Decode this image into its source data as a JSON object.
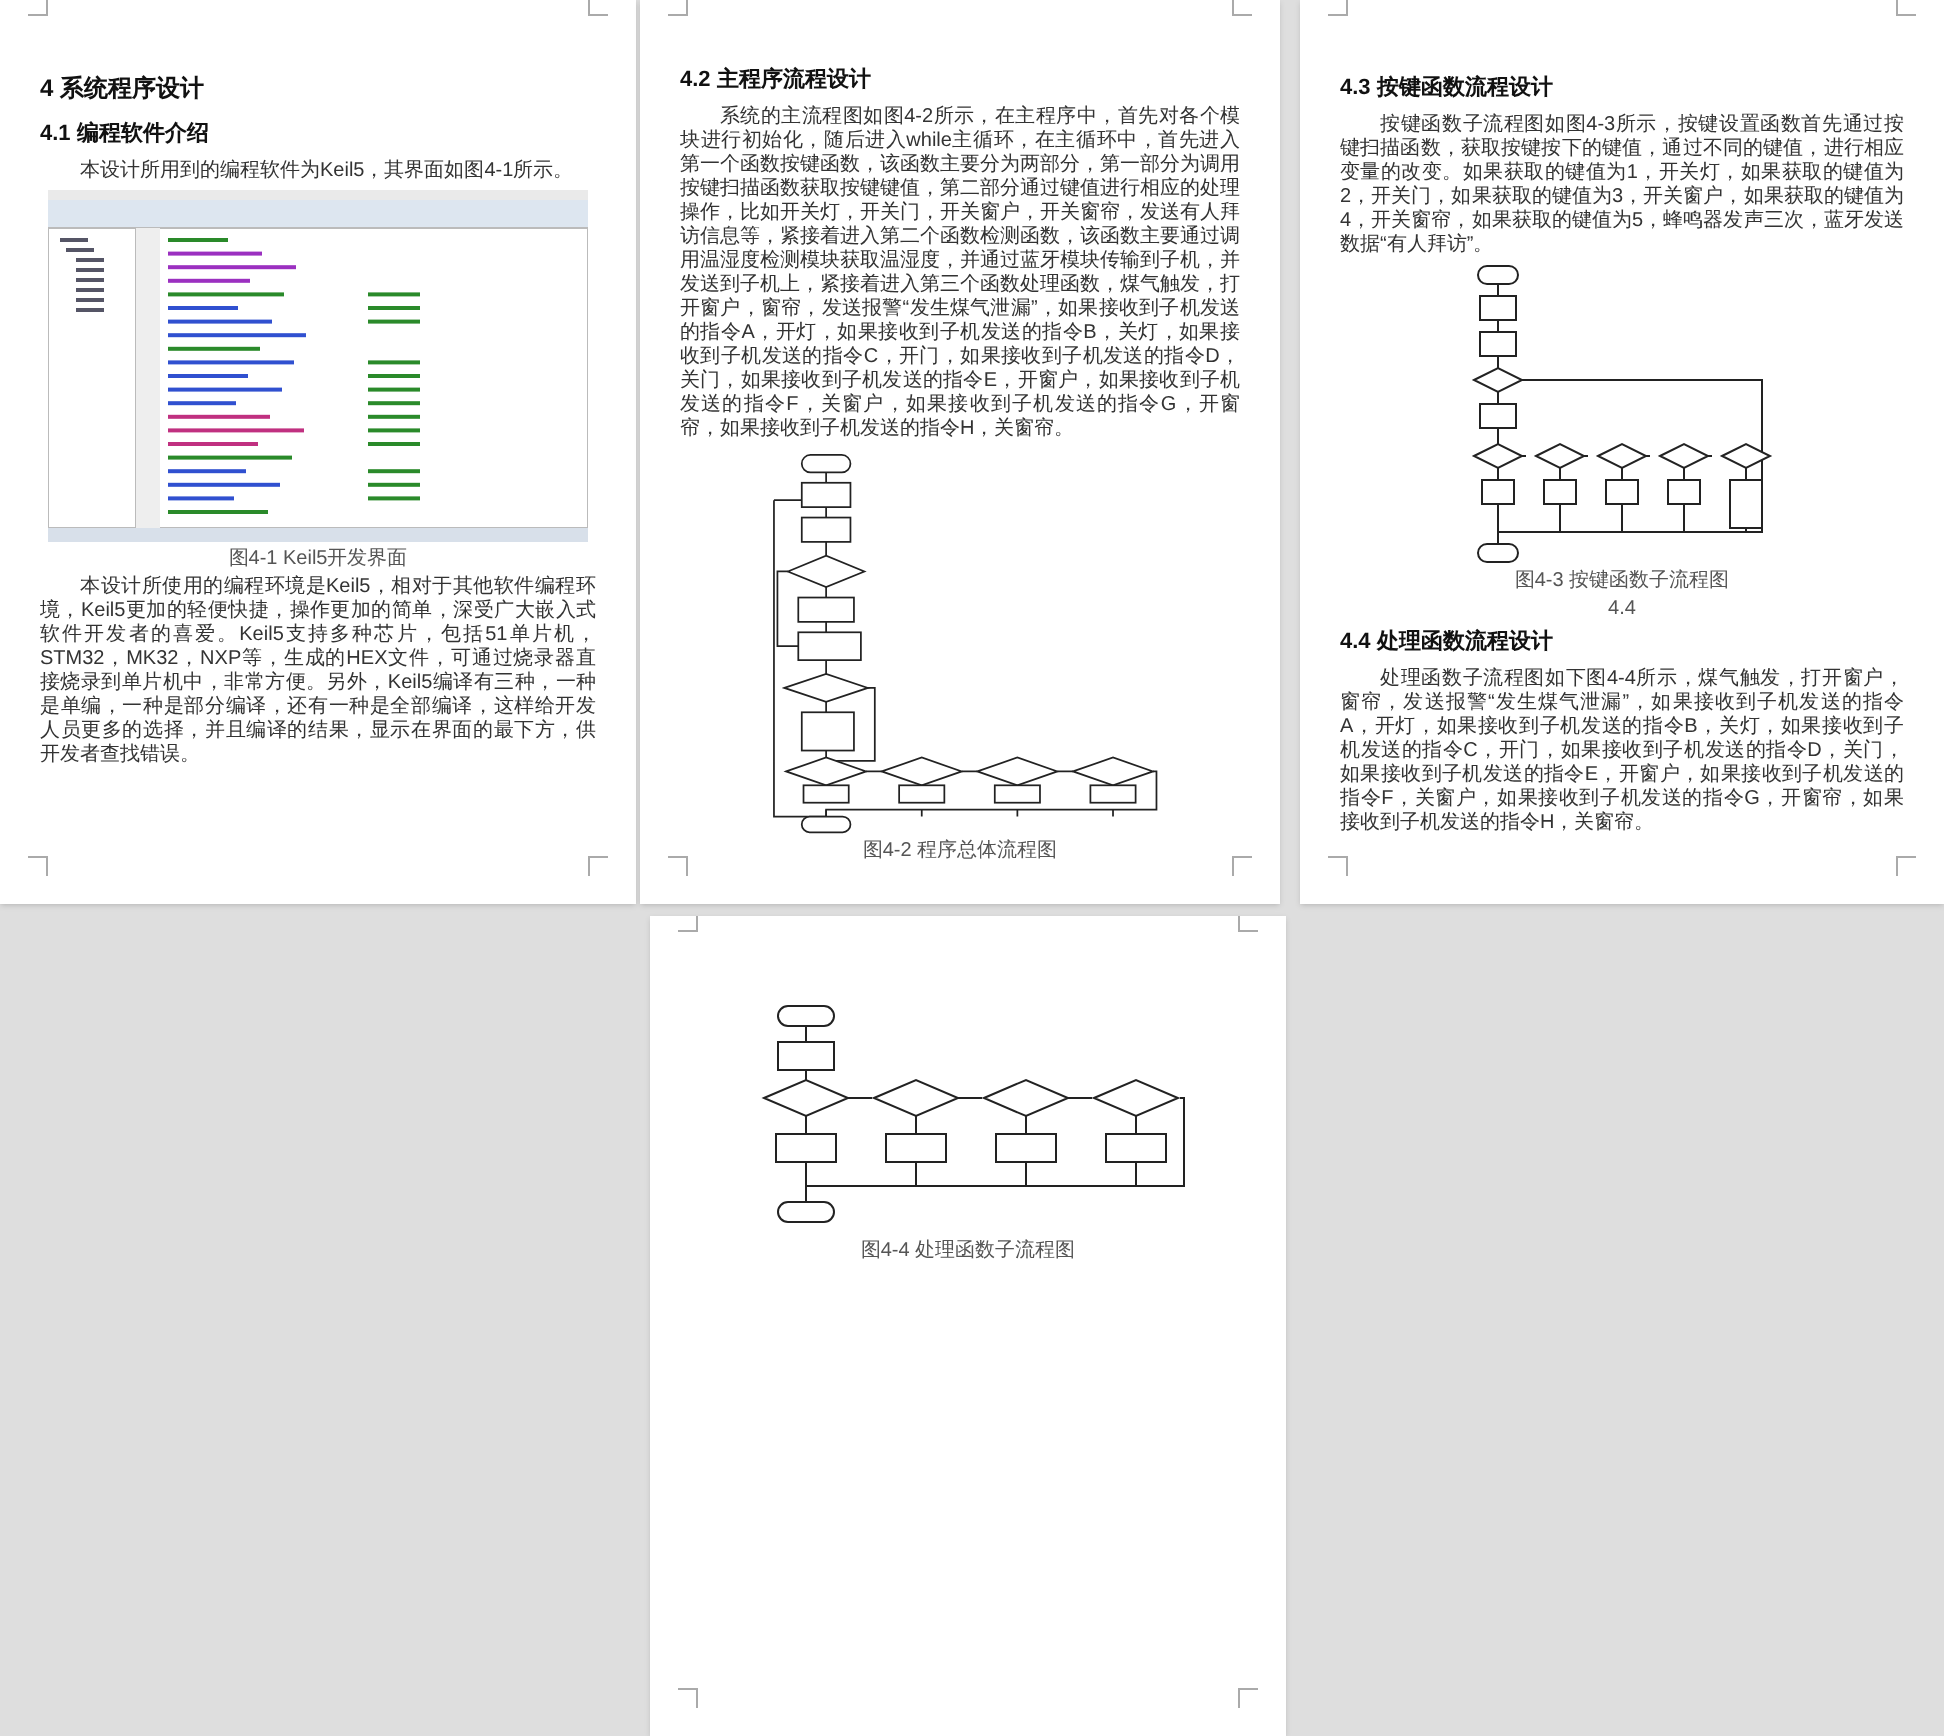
{
  "pages": [
    {
      "blocks": [
        {
          "kind": "heading1",
          "text": "4  系统程序设计"
        },
        {
          "kind": "heading2",
          "text": "4.1  编程软件介绍"
        },
        {
          "kind": "paragraph",
          "text": "本设计所用到的编程软件为Keil5，其界面如图4-1所示。"
        },
        {
          "kind": "ide-figure"
        },
        {
          "kind": "caption",
          "text": "图4-1 Keil5开发界面"
        },
        {
          "kind": "paragraph",
          "text": "本设计所使用的编程环境是Keil5，相对于其他软件编程环境，Keil5更加的轻便快捷，操作更加的简单，深受广大嵌入式软件开发者的喜爱。Keil5支持多种芯片，包括51单片机，STM32，MK32，NXP等，生成的HEX文件，可通过烧录器直接烧录到单片机中，非常方便。另外，Keil5编译有三种，一种是单编，一种是部分编译，还有一种是全部编译，这样给开发人员更多的选择，并且编译的结果，显示在界面的最下方，供开发者查找错误。"
        }
      ]
    },
    {
      "blocks": [
        {
          "kind": "heading2",
          "text": "4.2  主程序流程设计"
        },
        {
          "kind": "paragraph",
          "text": "系统的主流程图如图4-2所示，在主程序中，首先对各个模块进行初始化，随后进入while主循环，在主循环中，首先进入第一个函数按键函数，该函数主要分为两部分，第一部分为调用按键扫描函数获取按键键值，第二部分通过键值进行相应的处理操作，比如开关灯，开关门，开关窗户，开关窗帘，发送有人拜访信息等，紧接着进入第二个函数检测函数，该函数主要通过调用温湿度检测模块获取温湿度，并通过蓝牙模块传输到子机，并发送到子机上，紧接着进入第三个函数处理函数，煤气触发，打开窗户，窗帘，发送报警“发生煤气泄漏”，如果接收到子机发送的指令A，开灯，如果接收到子机发送的指令B，关灯，如果接收到子机发送的指令C，开门，如果接收到子机发送的指令D，关门，如果接收到子机发送的指令E，开窗户，如果接收到子机发送的指令F，关窗户，如果接收到子机发送的指令G，开窗帘，如果接收到子机发送的指令H，关窗帘。"
        },
        {
          "kind": "main-flowchart"
        },
        {
          "kind": "caption",
          "text": "图4-2  程序总体流程图"
        }
      ]
    },
    {
      "blocks": [
        {
          "kind": "heading2",
          "text": "4.3  按键函数流程设计"
        },
        {
          "kind": "paragraph",
          "text": "按键函数子流程图如图4-3所示，按键设置函数首先通过按键扫描函数，获取按键按下的键值，通过不同的键值，进行相应变量的改变。如果获取的键值为1，开关灯，如果获取的键值为2，开关门，如果获取的键值为3，开关窗户，如果获取的键值为4，开关窗帘，如果获取的键值为5，蜂鸣器发声三次，蓝牙发送数据“有人拜访”。"
        },
        {
          "kind": "key-flowchart"
        },
        {
          "kind": "caption",
          "text": "图4-3  按键函数子流程图"
        },
        {
          "kind": "caption",
          "text": "4.4"
        },
        {
          "kind": "heading2",
          "text": "4.4  处理函数流程设计"
        },
        {
          "kind": "paragraph",
          "text": "处理函数子流程图如下图4-4所示，煤气触发，打开窗户，窗帘，发送报警“发生煤气泄漏”，如果接收到子机发送的指令A，开灯，如果接收到子机发送的指令B，关灯，如果接收到子机发送的指令C，开门，如果接收到子机发送的指令D，关门，如果接收到子机发送的指令E，开窗户，如果接收到子机发送的指令F，关窗户，如果接收到子机发送的指令G，开窗帘，如果接收到子机发送的指令H，关窗帘。"
        }
      ]
    },
    {
      "blocks": [
        {
          "kind": "process-flowchart"
        },
        {
          "kind": "caption",
          "text": "图4-4  处理函数子流程图"
        }
      ]
    }
  ]
}
